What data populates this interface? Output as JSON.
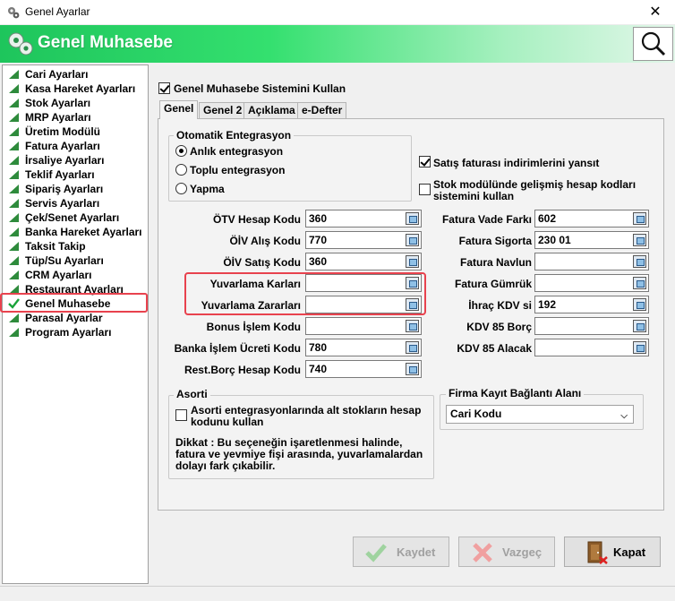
{
  "window": {
    "title": "Genel Ayarlar",
    "close_glyph": "✕",
    "icon": "app-icon"
  },
  "header": {
    "title": "Genel Muhasebe",
    "icon": "gear-icon",
    "search_icon": "search-icon"
  },
  "sidebar": {
    "items": [
      {
        "label": "Cari Ayarları"
      },
      {
        "label": "Kasa Hareket Ayarları"
      },
      {
        "label": "Stok Ayarları"
      },
      {
        "label": "MRP Ayarları"
      },
      {
        "label": "Üretim Modülü"
      },
      {
        "label": "Fatura Ayarları"
      },
      {
        "label": "İrsaliye Ayarları"
      },
      {
        "label": "Teklif Ayarları"
      },
      {
        "label": "Sipariş Ayarları"
      },
      {
        "label": "Servis Ayarları"
      },
      {
        "label": "Çek/Senet Ayarları"
      },
      {
        "label": "Banka Hareket Ayarları"
      },
      {
        "label": "Taksit Takip"
      },
      {
        "label": "Tüp/Su Ayarları"
      },
      {
        "label": "CRM Ayarları"
      },
      {
        "label": "Restaurant Ayarları"
      },
      {
        "label": "Genel Muhasebe",
        "selected": true
      },
      {
        "label": "Parasal Ayarlar"
      },
      {
        "label": "Program Ayarları"
      }
    ],
    "colors": {
      "triangle": "#2e8b3c",
      "check": "#1aa33a",
      "highlight": "#e8424e"
    }
  },
  "main": {
    "use_system": {
      "label": "Genel Muhasebe Sistemini Kullan",
      "checked": true
    },
    "tabs": [
      {
        "label": "Genel",
        "active": true
      },
      {
        "label": "Genel 2"
      },
      {
        "label": "Açıklama"
      },
      {
        "label": "e-Defter"
      }
    ],
    "auto_integration": {
      "legend": "Otomatik Entegrasyon",
      "options": [
        "Anlık entegrasyon",
        "Toplu entegrasyon",
        "Yapma"
      ],
      "selected_index": 0
    },
    "reflect_discount": {
      "label": "Satış faturası indirimlerini yansıt",
      "checked": true
    },
    "advanced_stock": {
      "label_line1": "Stok modülünde gelişmiş hesap kodları",
      "label_line2": "sistemini kullan",
      "checked": false
    },
    "left_fields": [
      {
        "label": "ÖTV Hesap Kodu",
        "value": "360"
      },
      {
        "label": "ÖİV Alış Kodu",
        "value": "770"
      },
      {
        "label": "ÖİV Satış Kodu",
        "value": "360"
      },
      {
        "label": "Yuvarlama Karları",
        "value": ""
      },
      {
        "label": "Yuvarlama Zararları",
        "value": ""
      },
      {
        "label": "Bonus İşlem Kodu",
        "value": ""
      },
      {
        "label": "Banka İşlem Ücreti Kodu",
        "value": "780"
      },
      {
        "label": "Rest.Borç Hesap Kodu",
        "value": "740"
      }
    ],
    "right_fields": [
      {
        "label": "Fatura Vade Farkı",
        "value": "602"
      },
      {
        "label": "Fatura Sigorta",
        "value": "230 01"
      },
      {
        "label": "Fatura Navlun",
        "value": ""
      },
      {
        "label": "Fatura Gümrük",
        "value": ""
      },
      {
        "label": "İhraç KDV si",
        "value": "192"
      },
      {
        "label": "KDV 85 Borç",
        "value": ""
      },
      {
        "label": "KDV 85 Alacak",
        "value": ""
      }
    ],
    "asorti": {
      "legend": "Asorti",
      "checkbox_line1": "Asorti entegrasyonlarında alt stokların hesap",
      "checkbox_line2": "kodunu kullan",
      "checked": false,
      "note_line1": "Dikkat : Bu seçeneğin işaretlenmesi halinde,",
      "note_line2": "fatura ve yevmiye fişi arasında, yuvarlamalardan",
      "note_line3": "dolayı fark çıkabilir."
    },
    "firma": {
      "legend": "Firma Kayıt Bağlantı Alanı",
      "selected": "Cari Kodu"
    }
  },
  "buttons": {
    "save": {
      "label": "Kaydet",
      "icon": "checkmark-icon",
      "enabled": false
    },
    "cancel": {
      "label": "Vazgeç",
      "icon": "x-icon",
      "enabled": false
    },
    "close": {
      "label": "Kapat",
      "icon": "exit-door-icon",
      "enabled": true
    }
  }
}
